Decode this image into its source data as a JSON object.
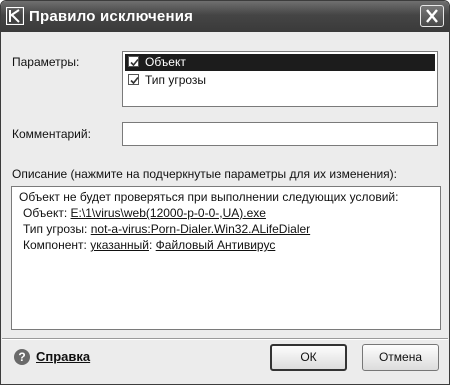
{
  "dialog": {
    "title": "Правило исключения"
  },
  "params": {
    "label": "Параметры:",
    "items": [
      {
        "label": "Объект",
        "checked": true,
        "selected": true
      },
      {
        "label": "Тип угрозы",
        "checked": true,
        "selected": false
      }
    ]
  },
  "comment": {
    "label": "Комментарий:",
    "value": ""
  },
  "description": {
    "label": "Описание (нажмите на подчеркнутые параметры для их изменения):",
    "intro": "Объект не будет проверяться при выполнении следующих условий:",
    "object_label": "Объект: ",
    "object_value": "E:\\1\\virus\\web(12000-p-0-0-,UA).exe",
    "threat_label": "Тип угрозы: ",
    "threat_value": "not-a-virus:Porn-Dialer.Win32.ALifeDialer",
    "component_label": "Компонент: ",
    "component_mode": "указанный",
    "component_sep": ": ",
    "component_value": "Файловый Антивирус"
  },
  "footer": {
    "help_label": "Справка",
    "ok_label": "ОК",
    "cancel_label": "Отмена"
  },
  "colors": {
    "titlebar": "#454545",
    "selection": "#1c1c1c"
  }
}
